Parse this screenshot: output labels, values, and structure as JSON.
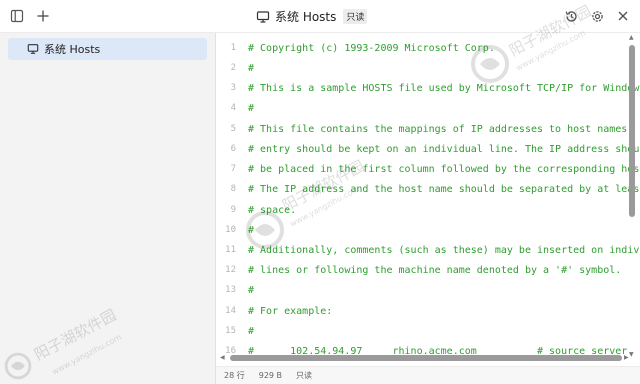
{
  "window": {
    "title": "系统 Hosts",
    "readonly_badge": "只读"
  },
  "sidebar": {
    "items": [
      {
        "label": "系统 Hosts",
        "icon": "monitor-icon",
        "selected": true
      }
    ]
  },
  "editor": {
    "lines": [
      {
        "n": "1",
        "text": "# Copyright (c) 1993-2009 Microsoft Corp."
      },
      {
        "n": "2",
        "text": "#"
      },
      {
        "n": "3",
        "text": "# This is a sample HOSTS file used by Microsoft TCP/IP for Windows."
      },
      {
        "n": "4",
        "text": "#"
      },
      {
        "n": "5",
        "text": "# This file contains the mappings of IP addresses to host names. Each"
      },
      {
        "n": "6",
        "text": "# entry should be kept on an individual line. The IP address should"
      },
      {
        "n": "7",
        "text": "# be placed in the first column followed by the corresponding host name."
      },
      {
        "n": "8",
        "text": "# The IP address and the host name should be separated by at least one"
      },
      {
        "n": "9",
        "text": "# space."
      },
      {
        "n": "10",
        "text": "#"
      },
      {
        "n": "11",
        "text": "# Additionally, comments (such as these) may be inserted on individual"
      },
      {
        "n": "12",
        "text": "# lines or following the machine name denoted by a '#' symbol."
      },
      {
        "n": "13",
        "text": "#"
      },
      {
        "n": "14",
        "text": "# For example:"
      },
      {
        "n": "15",
        "text": "#"
      },
      {
        "n": "16",
        "text": "#      102.54.94.97     rhino.acme.com          # source server"
      }
    ]
  },
  "statusbar": {
    "lines": "28 行",
    "size": "929 B",
    "mode": "只读"
  },
  "watermark": {
    "text": "阳子湖软件园",
    "url": "www.yangzihu.com"
  },
  "colors": {
    "code": "#2f9e2f",
    "selected_bg": "#dce7f7",
    "sidebar_bg": "#f3f3f4"
  }
}
